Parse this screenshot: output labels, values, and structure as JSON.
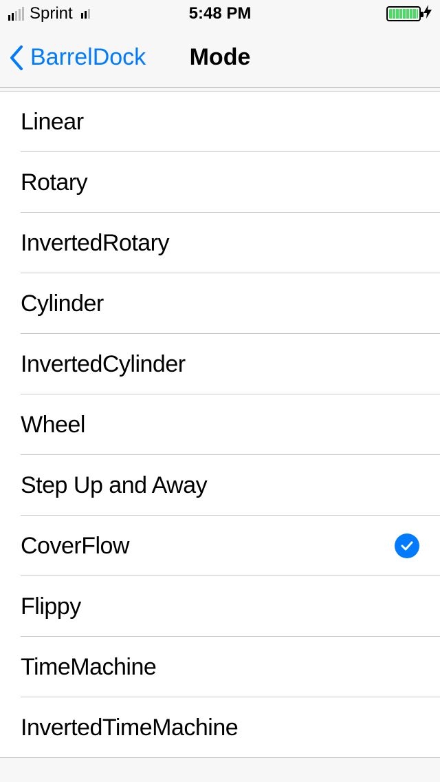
{
  "status": {
    "carrier": "Sprint",
    "time": "5:48 PM"
  },
  "nav": {
    "back_label": "BarrelDock",
    "title": "Mode"
  },
  "items": [
    {
      "label": "Linear",
      "selected": false
    },
    {
      "label": "Rotary",
      "selected": false
    },
    {
      "label": "InvertedRotary",
      "selected": false
    },
    {
      "label": "Cylinder",
      "selected": false
    },
    {
      "label": "InvertedCylinder",
      "selected": false
    },
    {
      "label": "Wheel",
      "selected": false
    },
    {
      "label": "Step Up and Away",
      "selected": false
    },
    {
      "label": "CoverFlow",
      "selected": true
    },
    {
      "label": "Flippy",
      "selected": false
    },
    {
      "label": "TimeMachine",
      "selected": false
    },
    {
      "label": "InvertedTimeMachine",
      "selected": false
    }
  ]
}
